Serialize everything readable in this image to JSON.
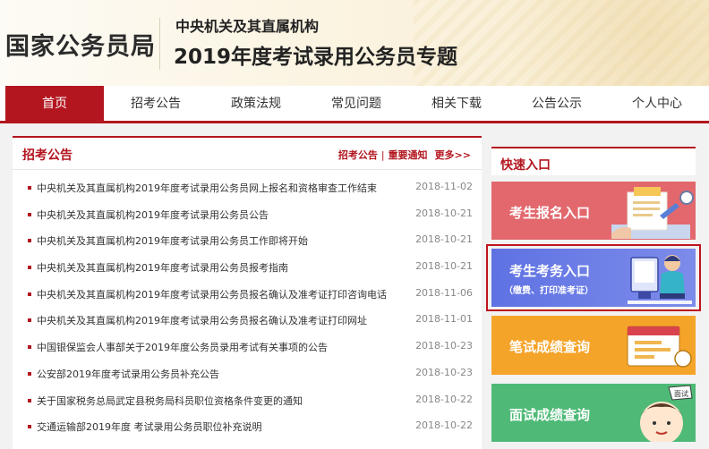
{
  "header": {
    "org": "国家公务员局",
    "subtitle": "中央机关及其直属机构",
    "title": "2019年度考试录用公务员专题"
  },
  "nav": {
    "items": [
      {
        "label": "首页",
        "active": true
      },
      {
        "label": "招考公告"
      },
      {
        "label": "政策法规"
      },
      {
        "label": "常见问题"
      },
      {
        "label": "相关下载"
      },
      {
        "label": "公告公示"
      },
      {
        "label": "个人中心"
      }
    ]
  },
  "announcements": {
    "title": "招考公告",
    "link1": "招考公告",
    "separator": "|",
    "link2": "重要通知",
    "more": "更多>>",
    "items": [
      {
        "text": "中央机关及其直属机构2019年度考试录用公务员网上报名和资格审查工作结束",
        "date": "2018-11-02"
      },
      {
        "text": "中央机关及其直属机构2019年度考试录用公务员公告",
        "date": "2018-10-21"
      },
      {
        "text": "中央机关及其直属机构2019年度考试录用公务员工作即将开始",
        "date": "2018-10-21"
      },
      {
        "text": "中央机关及其直属机构2019年度考试录用公务员报考指南",
        "date": "2018-10-21"
      },
      {
        "text": "中央机关及其直属机构2019年度考试录用公务员报名确认及准考证打印咨询电话",
        "date": "2018-11-06"
      },
      {
        "text": "中央机关及其直属机构2019年度考试录用公务员报名确认及准考证打印网址",
        "date": "2018-11-01"
      },
      {
        "text": "中国银保监会人事部关于2019年度公务员录用考试有关事项的公告",
        "date": "2018-10-23"
      },
      {
        "text": "公安部2019年度考试录用公务员补充公告",
        "date": "2018-10-23"
      },
      {
        "text": "关于国家税务总局武定县税务局科员职位资格条件变更的通知",
        "date": "2018-10-22"
      },
      {
        "text": "交通运输部2019年度 考试录用公务员职位补充说明",
        "date": "2018-10-22"
      }
    ]
  },
  "quick": {
    "title": "快速入口",
    "register": "考生报名入口",
    "exam": "考生考务入口",
    "exam_sub": "（缴费、打印准考证）",
    "written": "笔试成绩查询",
    "interview": "面试成绩查询",
    "interview_badge": "面试"
  },
  "colors": {
    "brand_red": "#b3161f",
    "register_bg": "#e2686e",
    "exam_bg": "#6a7ce6",
    "written_bg": "#f5a42a",
    "interview_bg": "#4fba77"
  }
}
